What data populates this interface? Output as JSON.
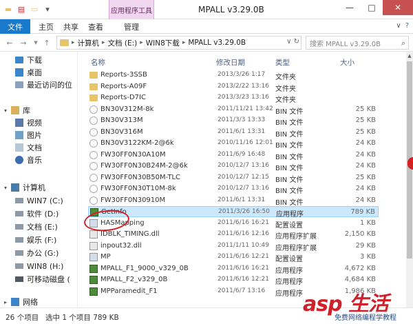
{
  "titlebar": {
    "title": "MPALL v3.29.0B",
    "context_tab_group": "应用程序工具",
    "controls": {
      "minimize": "—",
      "maximize": "□",
      "close": "✕"
    }
  },
  "ribbon": {
    "tabs": [
      "文件",
      "主页",
      "共享",
      "查看",
      "管理"
    ],
    "right": {
      "collapse": "∨",
      "help": "?"
    }
  },
  "address": {
    "back": "←",
    "forward": "→",
    "up": "↑",
    "crumbs": [
      "计算机",
      "文档 (E:)",
      "WIN8下载",
      "MPALL v3.29.0B"
    ],
    "tail": "∨ ↻",
    "search_placeholder": "搜索 MPALL v3.29.0B"
  },
  "sidebar": {
    "items": [
      {
        "label": "下载",
        "icon": "download-folder-icon"
      },
      {
        "label": "桌面",
        "icon": "desktop-icon"
      },
      {
        "label": "最近访问的位",
        "icon": "recent-places-icon"
      },
      {
        "label": "库",
        "icon": "libraries-icon"
      },
      {
        "label": "视频",
        "icon": "videos-icon"
      },
      {
        "label": "图片",
        "icon": "pictures-icon"
      },
      {
        "label": "文档",
        "icon": "documents-icon"
      },
      {
        "label": "音乐",
        "icon": "music-icon"
      },
      {
        "label": "计算机",
        "icon": "computer-icon"
      },
      {
        "label": "WIN7 (C:)",
        "icon": "drive-icon"
      },
      {
        "label": "软件 (D:)",
        "icon": "drive-icon"
      },
      {
        "label": "文档 (E:)",
        "icon": "drive-icon"
      },
      {
        "label": "娱乐 (F:)",
        "icon": "drive-icon"
      },
      {
        "label": "办公 (G:)",
        "icon": "drive-icon"
      },
      {
        "label": "WIN8 (H:)",
        "icon": "drive-icon"
      },
      {
        "label": "可移动磁盘 (",
        "icon": "removable-drive-icon"
      },
      {
        "label": "网络",
        "icon": "network-icon"
      }
    ]
  },
  "columns": {
    "name": "名称",
    "date": "修改日期",
    "type": "类型",
    "size": "大小"
  },
  "files": [
    {
      "name": "Reports-3SSB",
      "date": "2013/3/26 1:17",
      "type": "文件夹",
      "size": "",
      "kind": "folder"
    },
    {
      "name": "Reports-A09F",
      "date": "2013/2/22 13:16",
      "type": "文件夹",
      "size": "",
      "kind": "folder"
    },
    {
      "name": "Reports-D7IC",
      "date": "2013/3/23 13:16",
      "type": "文件夹",
      "size": "",
      "kind": "folder"
    },
    {
      "name": "BN30V312M-8k",
      "date": "2011/11/21 13:42",
      "type": "BIN 文件",
      "size": "25 KB",
      "kind": "bin"
    },
    {
      "name": "BN30V313M",
      "date": "2011/3/3 13:33",
      "type": "BIN 文件",
      "size": "25 KB",
      "kind": "bin"
    },
    {
      "name": "BN30V316M",
      "date": "2011/6/1 13:31",
      "type": "BIN 文件",
      "size": "25 KB",
      "kind": "bin"
    },
    {
      "name": "BN30V3122KM-2@6k",
      "date": "2010/11/16 12:01",
      "type": "BIN 文件",
      "size": "24 KB",
      "kind": "bin"
    },
    {
      "name": "FW30FF0N30A10M",
      "date": "2011/6/9 16:48",
      "type": "BIN 文件",
      "size": "24 KB",
      "kind": "bin"
    },
    {
      "name": "FW30FF0N30B24M-2@6k",
      "date": "2010/12/7 13:16",
      "type": "BIN 文件",
      "size": "24 KB",
      "kind": "bin"
    },
    {
      "name": "FW30FF0N30B50M-TLC",
      "date": "2010/12/7 12:15",
      "type": "BIN 文件",
      "size": "25 KB",
      "kind": "bin"
    },
    {
      "name": "FW30FF0N30T10M-8k",
      "date": "2010/12/7 13:16",
      "type": "BIN 文件",
      "size": "24 KB",
      "kind": "bin"
    },
    {
      "name": "FW30FF0N30910M",
      "date": "2011/6/1 13:31",
      "type": "BIN 文件",
      "size": "24 KB",
      "kind": "bin"
    },
    {
      "name": "GetInfo",
      "date": "2011/3/26 16:50",
      "type": "应用程序",
      "size": "789 KB",
      "kind": "exe"
    },
    {
      "name": "HASMapping",
      "date": "2011/6/16 16:21",
      "type": "配置设置",
      "size": "1 KB",
      "kind": "ini"
    },
    {
      "name": "IDBLK_TIMING.dll",
      "date": "2011/6/16 12:16",
      "type": "应用程序扩展",
      "size": "2,150 KB",
      "kind": "dll"
    },
    {
      "name": "inpout32.dll",
      "date": "2011/1/11 10:49",
      "type": "应用程序扩展",
      "size": "29 KB",
      "kind": "dll"
    },
    {
      "name": "MP",
      "date": "2011/6/16 12:21",
      "type": "配置设置",
      "size": "3 KB",
      "kind": "ini"
    },
    {
      "name": "MPALL_F1_9000_v329_0B",
      "date": "2011/6/16 16:21",
      "type": "应用程序",
      "size": "4,672 KB",
      "kind": "exe"
    },
    {
      "name": "MPALL_F2_v329_0B",
      "date": "2011/6/16 12:21",
      "type": "应用程序",
      "size": "4,684 KB",
      "kind": "exe"
    },
    {
      "name": "MPParamedit_F1",
      "date": "2011/6/7 13:16",
      "type": "应用程序",
      "size": "1,986 KB",
      "kind": "exe"
    }
  ],
  "status": {
    "count": "26 个项目",
    "selection": "选中 1 个项目 789 KB"
  },
  "watermark": {
    "logo": "asp 生活",
    "sub": "免费网络编程学教程"
  }
}
